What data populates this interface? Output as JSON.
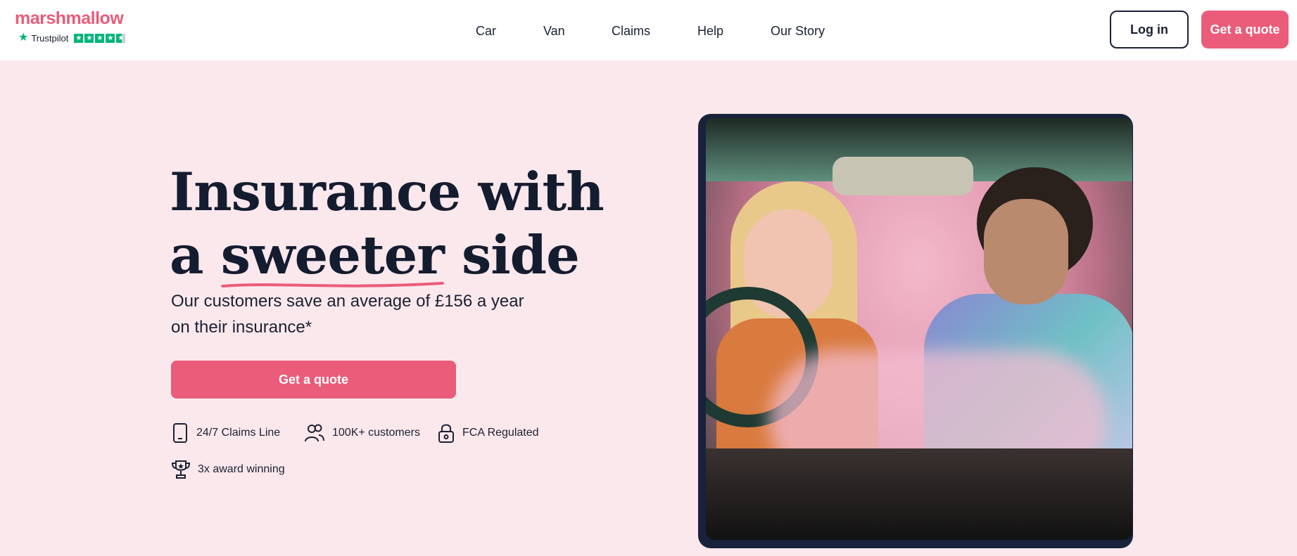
{
  "header": {
    "logo": "marshmallow",
    "trustpilot": {
      "label": "Trustpilot",
      "stars": 4.5
    },
    "nav": [
      "Car",
      "Van",
      "Claims",
      "Help",
      "Our Story"
    ],
    "login_label": "Log in",
    "quote_label": "Get a quote"
  },
  "hero": {
    "title_line1": "Insurance with",
    "title_a": "a",
    "title_highlight": "sweeter",
    "title_end": "side",
    "subtitle": "Our customers save an average of £156 a year on their insurance*",
    "cta_label": "Get a quote",
    "features": [
      {
        "icon": "phone-icon",
        "label": "24/7 Claims Line"
      },
      {
        "icon": "people-icon",
        "label": "100K+ customers"
      },
      {
        "icon": "lock-icon",
        "label": "FCA Regulated"
      },
      {
        "icon": "trophy-icon",
        "label": "3x award winning"
      }
    ]
  },
  "colors": {
    "brand": "#ea5c7a",
    "hero_background": "#fbe8ec",
    "text_dark": "#1b2133",
    "trustpilot_green": "#00b67a"
  }
}
